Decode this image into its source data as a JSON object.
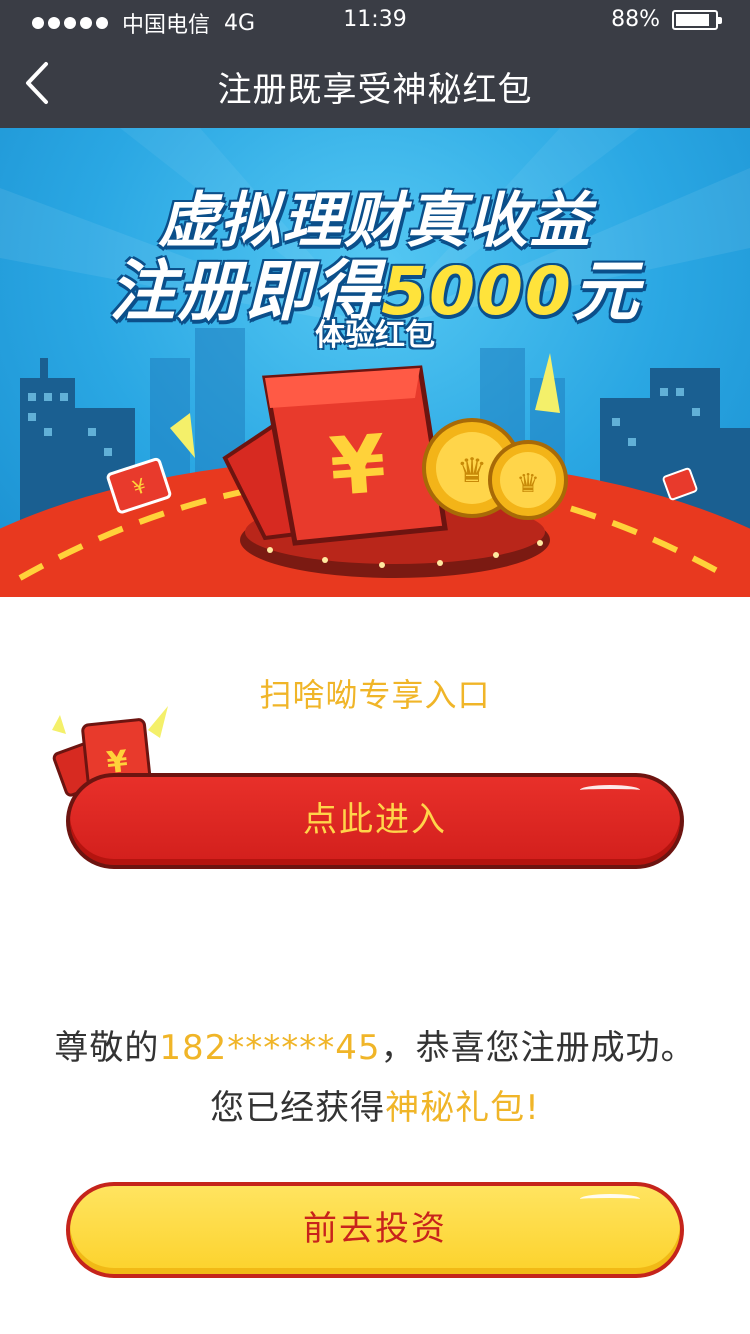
{
  "status_bar": {
    "carrier": "中国电信",
    "network": "4G",
    "time": "11:39",
    "battery": "88%",
    "battery_level": 0.88
  },
  "nav": {
    "title": "注册既享受神秘红包",
    "back_icon": "chevron-left-icon"
  },
  "banner": {
    "line1": "虚拟理财真收益",
    "line2_prefix": "注册即得",
    "line2_amount": "5000",
    "line2_suffix": "元",
    "line3": "体验红包",
    "colors": {
      "sky": "#2aa7e3",
      "stage": "#e8391f",
      "highlight": "#ffe33b"
    }
  },
  "entry": {
    "title": "扫啥呦专享入口",
    "button_label": "点此进入"
  },
  "message": {
    "line1_prefix": "尊敬的",
    "phone": "182******45",
    "line1_suffix": "，恭喜您注册成功。",
    "line2_prefix": "您已经获得",
    "line2_highlight": "神秘礼包!"
  },
  "invest_button": {
    "label": "前去投资"
  },
  "colors": {
    "header_bg": "#3a3d45",
    "accent_gold": "#f0b528",
    "button_red": "#d8231f",
    "button_yellow": "#fcd22b"
  }
}
